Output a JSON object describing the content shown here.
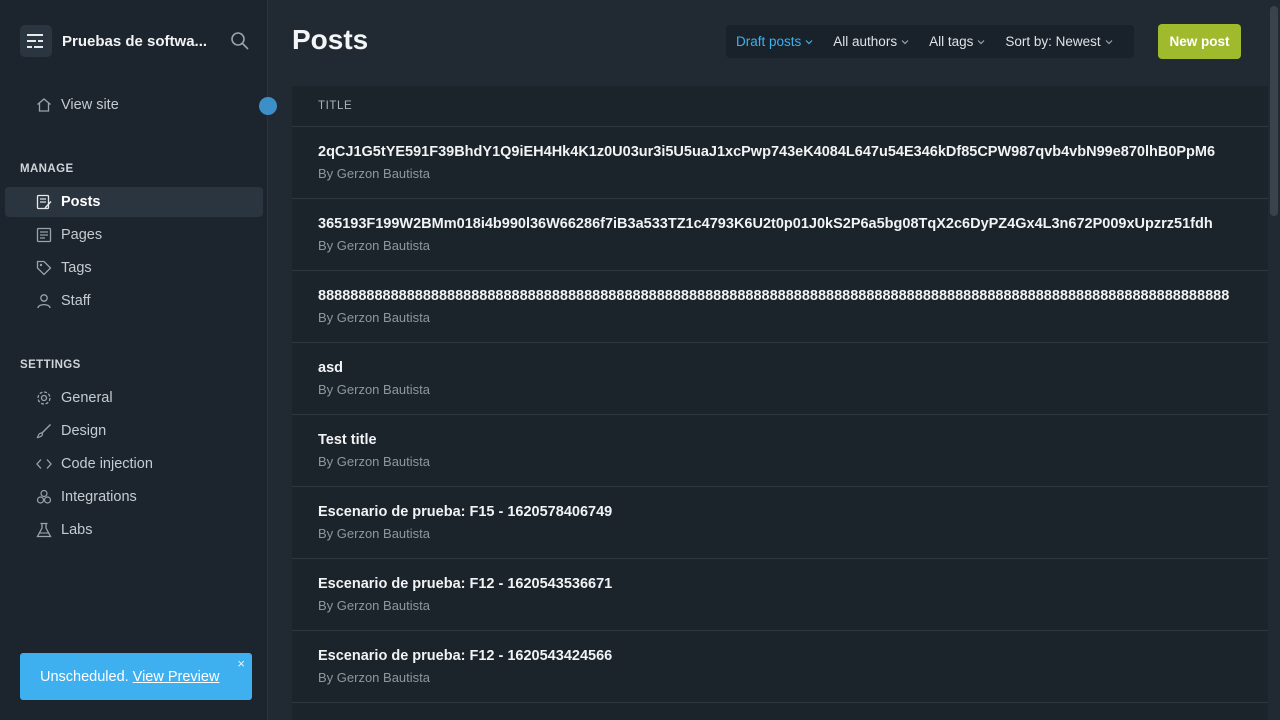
{
  "sidebar": {
    "site_title": "Pruebas de softwa...",
    "view_site": "View site",
    "manage_label": "MANAGE",
    "manage_items": [
      "Posts",
      "Pages",
      "Tags",
      "Staff"
    ],
    "settings_label": "SETTINGS",
    "settings_items": [
      "General",
      "Design",
      "Code injection",
      "Integrations",
      "Labs"
    ]
  },
  "toast": {
    "text": "Unscheduled.",
    "link": "View Preview",
    "close": "×"
  },
  "main": {
    "title": "Posts",
    "filters": [
      "Draft posts",
      "All authors",
      "All tags",
      "Sort by: Newest"
    ],
    "new_post": "New post",
    "column_header": "TITLE"
  },
  "posts": [
    {
      "title": "2qCJ1G5tYE591F39BhdY1Q9iEH4Hk4K1z0U03ur3i5U5uaJ1xcPwp743eK4084L647u54E346kDf85CPW987qvb4vbN99e870lhB0PpM6",
      "byline": "By Gerzon Bautista"
    },
    {
      "title": "365193F199W2BMm018i4b990l36W66286f7iB3a533TZ1c4793K6U2t0p01J0kS2P6a5bg08TqX2c6DyPZ4Gx4L3n672P009xUpzrz51fdh",
      "byline": "By Gerzon Bautista"
    },
    {
      "title": "88888888888888888888888888888888888888888888888888888888888888888888888888888888888888888888888888888888888888888",
      "byline": "By Gerzon Bautista"
    },
    {
      "title": "asd",
      "byline": "By Gerzon Bautista"
    },
    {
      "title": "Test title",
      "byline": "By Gerzon Bautista"
    },
    {
      "title": "Escenario de prueba: F15 - 1620578406749",
      "byline": "By Gerzon Bautista"
    },
    {
      "title": "Escenario de prueba: F12 - 1620543536671",
      "byline": "By Gerzon Bautista"
    },
    {
      "title": "Escenario de prueba: F12 - 1620543424566",
      "byline": "By Gerzon Bautista"
    }
  ],
  "colors": {
    "accent": "#3eb0ef",
    "primary_button": "#9fbb2d",
    "sidebar_bg": "#1c252d",
    "main_bg": "#212a33"
  }
}
